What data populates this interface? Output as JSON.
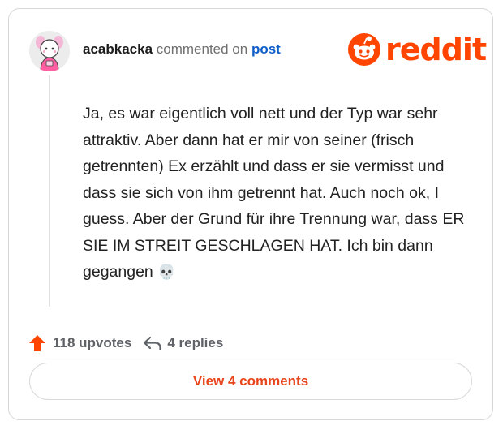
{
  "comment": {
    "username": "acabkacka",
    "action_text": "commented on",
    "post_link": "post",
    "body_text": "Ja, es war eigentlich voll nett und der Typ war sehr attraktiv. Aber dann hat er mir von seiner (frisch getrennten) Ex erzählt und dass er sie vermisst und dass sie sich von ihm getrennt hat. Auch noch ok, I guess. Aber der Grund für ihre Trennung war, dass ER SIE IM STREIT GESCHLAGEN HAT. Ich bin dann gegangen",
    "trailing_emoji": "💀"
  },
  "logo": {
    "wordmark": "reddit"
  },
  "stats": {
    "upvotes": "118 upvotes",
    "replies": "4 replies"
  },
  "actions": {
    "view_comments_label": "View 4 comments"
  },
  "colors": {
    "brand_orange": "#ff4500",
    "upvote_orange": "#ff4500",
    "link_blue": "#0f5fc9",
    "button_text": "#e8461d"
  },
  "icons": {
    "avatar": "cartoon-avatar",
    "logo": "reddit-snoo-icon",
    "upvote": "upvote-arrow-icon",
    "reply": "reply-arrow-icon",
    "emoji": "skull-emoji"
  }
}
